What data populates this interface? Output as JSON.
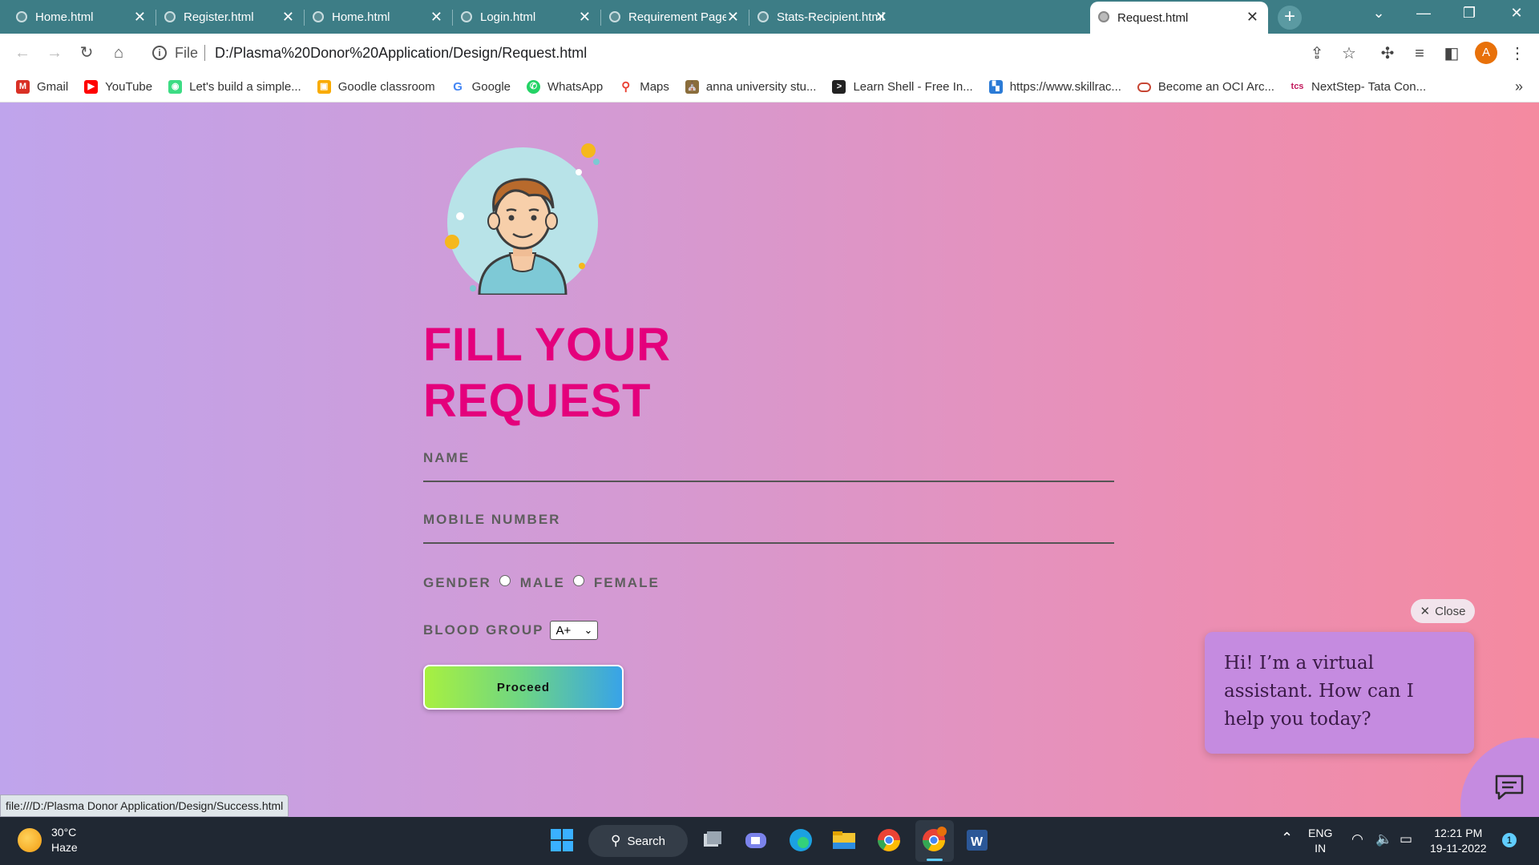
{
  "browser": {
    "tabs": [
      {
        "label": "Home.html"
      },
      {
        "label": "Register.html"
      },
      {
        "label": "Home.html"
      },
      {
        "label": "Login.html"
      },
      {
        "label": "Requirement Page.htm"
      },
      {
        "label": "Stats-Recipient.html"
      },
      {
        "label": "Request.html",
        "active": true
      }
    ],
    "address": {
      "scheme": "File",
      "url": "D:/Plasma%20Donor%20Application/Design/Request.html"
    },
    "profile_initial": "A",
    "bookmarks": [
      {
        "label": "Gmail",
        "icon": "gmail-icon",
        "color": "#d93025"
      },
      {
        "label": "YouTube",
        "icon": "youtube-icon",
        "color": "#ff0000"
      },
      {
        "label": "Let's build a simple...",
        "icon": "android-icon",
        "color": "#3ddc84"
      },
      {
        "label": "Goodle classroom",
        "icon": "classroom-icon",
        "color": "#f9ab00"
      },
      {
        "label": "Google",
        "icon": "google-icon",
        "color": "#4285f4"
      },
      {
        "label": "WhatsApp",
        "icon": "whatsapp-icon",
        "color": "#25d366"
      },
      {
        "label": "Maps",
        "icon": "maps-icon",
        "color": "#ea4335"
      },
      {
        "label": "anna university stu...",
        "icon": "university-icon",
        "color": "#8a6d3b"
      },
      {
        "label": "Learn Shell - Free In...",
        "icon": "terminal-icon",
        "color": "#222222"
      },
      {
        "label": "https://www.skillrac...",
        "icon": "skillrack-icon",
        "color": "#2b7bd6"
      },
      {
        "label": "Become an OCI Arc...",
        "icon": "oracle-icon",
        "color": "#c74634"
      },
      {
        "label": "NextStep- Tata Con...",
        "icon": "tcs-icon",
        "color": "#c2185b"
      }
    ]
  },
  "form": {
    "heading_line1": "FILL YOUR",
    "heading_line2": "REQUEST",
    "name_label": "NAME",
    "mobile_label": "MOBILE NUMBER",
    "gender_label": "GENDER",
    "gender_male": "MALE",
    "gender_female": "FEMALE",
    "blood_label": "BLOOD GROUP",
    "blood_selected": "A+",
    "proceed_label": "Proceed"
  },
  "assistant": {
    "close_label": "Close",
    "message": "Hi! I’m a virtual assistant. How can I help you today?"
  },
  "status_bar_url": "file:///D:/Plasma Donor Application/Design/Success.html",
  "taskbar": {
    "temperature": "30°C",
    "weather": "Haze",
    "search_label": "Search",
    "lang_line1": "ENG",
    "lang_line2": "IN",
    "time": "12:21 PM",
    "date": "19-11-2022",
    "notification_count": "1"
  },
  "colors": {
    "heading": "#e4007c",
    "tab_strip": "#3d7d86",
    "assistant_bubble": "#c58be0"
  }
}
